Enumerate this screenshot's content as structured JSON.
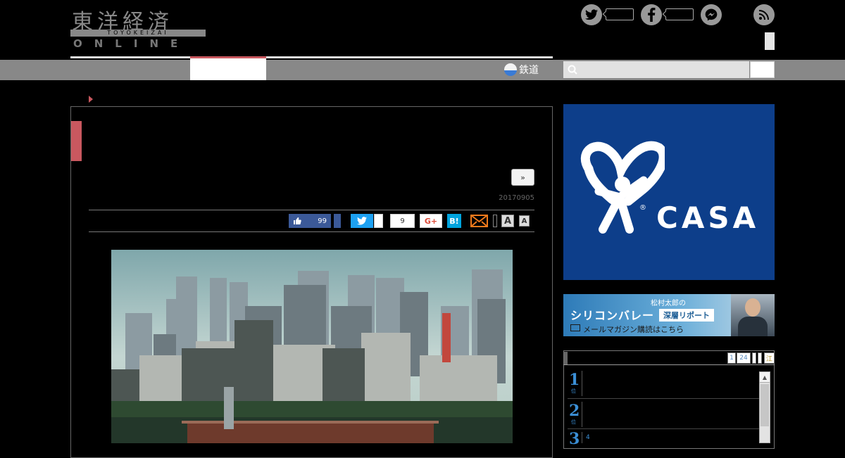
{
  "logo": {
    "kanji": "東洋経済",
    "subtitle": "TOYOKEIZAI",
    "online": "ONLINE"
  },
  "social_header": [
    {
      "icon": "twitter-icon",
      "color": "#999999"
    },
    {
      "icon": "facebook-icon",
      "color": "#999999"
    },
    {
      "icon": "messenger-icon",
      "color": "#999999"
    },
    {
      "icon": "rss-icon",
      "color": "#999999"
    }
  ],
  "nav": {
    "railway_label": "鉄道",
    "active_color": "#c9585f"
  },
  "search": {
    "placeholder": ""
  },
  "article": {
    "next_label": "»",
    "date": "20170905",
    "share": {
      "like_count": "99",
      "hatena_count": "9",
      "gplus_label": "G+",
      "hatebu_label": "B!",
      "font_large": "A",
      "font_small": "A"
    }
  },
  "sidebar": {
    "ad_casa": {
      "brand": "CASA",
      "registered": "®",
      "background": "#0d3e8a"
    },
    "ad_silicon": {
      "author": "松村太郎の",
      "title": "シリコンバレー",
      "badge": "深層リポート",
      "cta": "メールマガジン購読はこちら"
    },
    "ranking": {
      "tabs": [
        "1",
        "24",
        "",
        "",
        "江"
      ],
      "rows": [
        {
          "rank": "1",
          "unit": "位"
        },
        {
          "rank": "2",
          "unit": "位"
        },
        {
          "rank": "3",
          "unit": "位"
        }
      ],
      "extra": "4"
    }
  }
}
